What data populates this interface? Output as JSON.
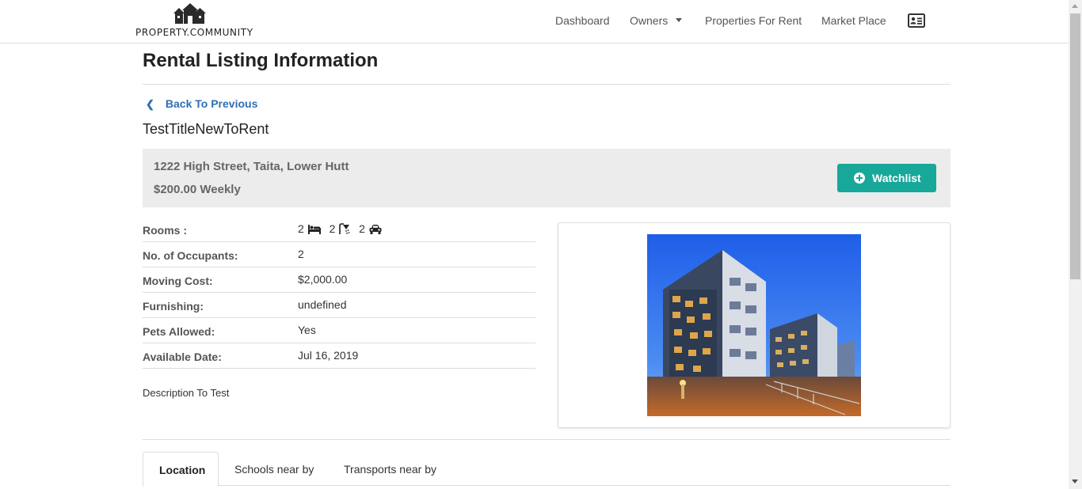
{
  "header": {
    "logo_text": "PROPERTY.COMMUNITY",
    "nav": {
      "dashboard": "Dashboard",
      "owners": "Owners",
      "properties_for_rent": "Properties For Rent",
      "market_place": "Market Place"
    },
    "profile_icon": "id-card-icon"
  },
  "page": {
    "title": "Rental Listing Information",
    "back_label": "Back To Previous",
    "listing_title": "TestTitleNewToRent"
  },
  "summary": {
    "address": "1222 High Street, Taita, Lower Hutt",
    "price": "$200.00 Weekly",
    "watchlist_label": "Watchlist",
    "accent_color": "#17a89a"
  },
  "details": {
    "rooms_label": "Rooms :",
    "bedrooms": "2",
    "bathrooms": "2",
    "carparks": "2",
    "occupants_label": "No. of Occupants:",
    "occupants": "2",
    "moving_cost_label": "Moving Cost:",
    "moving_cost": "$2,000.00",
    "furnishing_label": "Furnishing:",
    "furnishing": "undefined",
    "pets_label": "Pets Allowed:",
    "pets": "Yes",
    "available_label": "Available Date:",
    "available_date": "Jul 16, 2019"
  },
  "description": "Description To Test",
  "tabs": [
    "Location",
    "Schools near by",
    "Transports near by"
  ],
  "active_tab": "Location"
}
